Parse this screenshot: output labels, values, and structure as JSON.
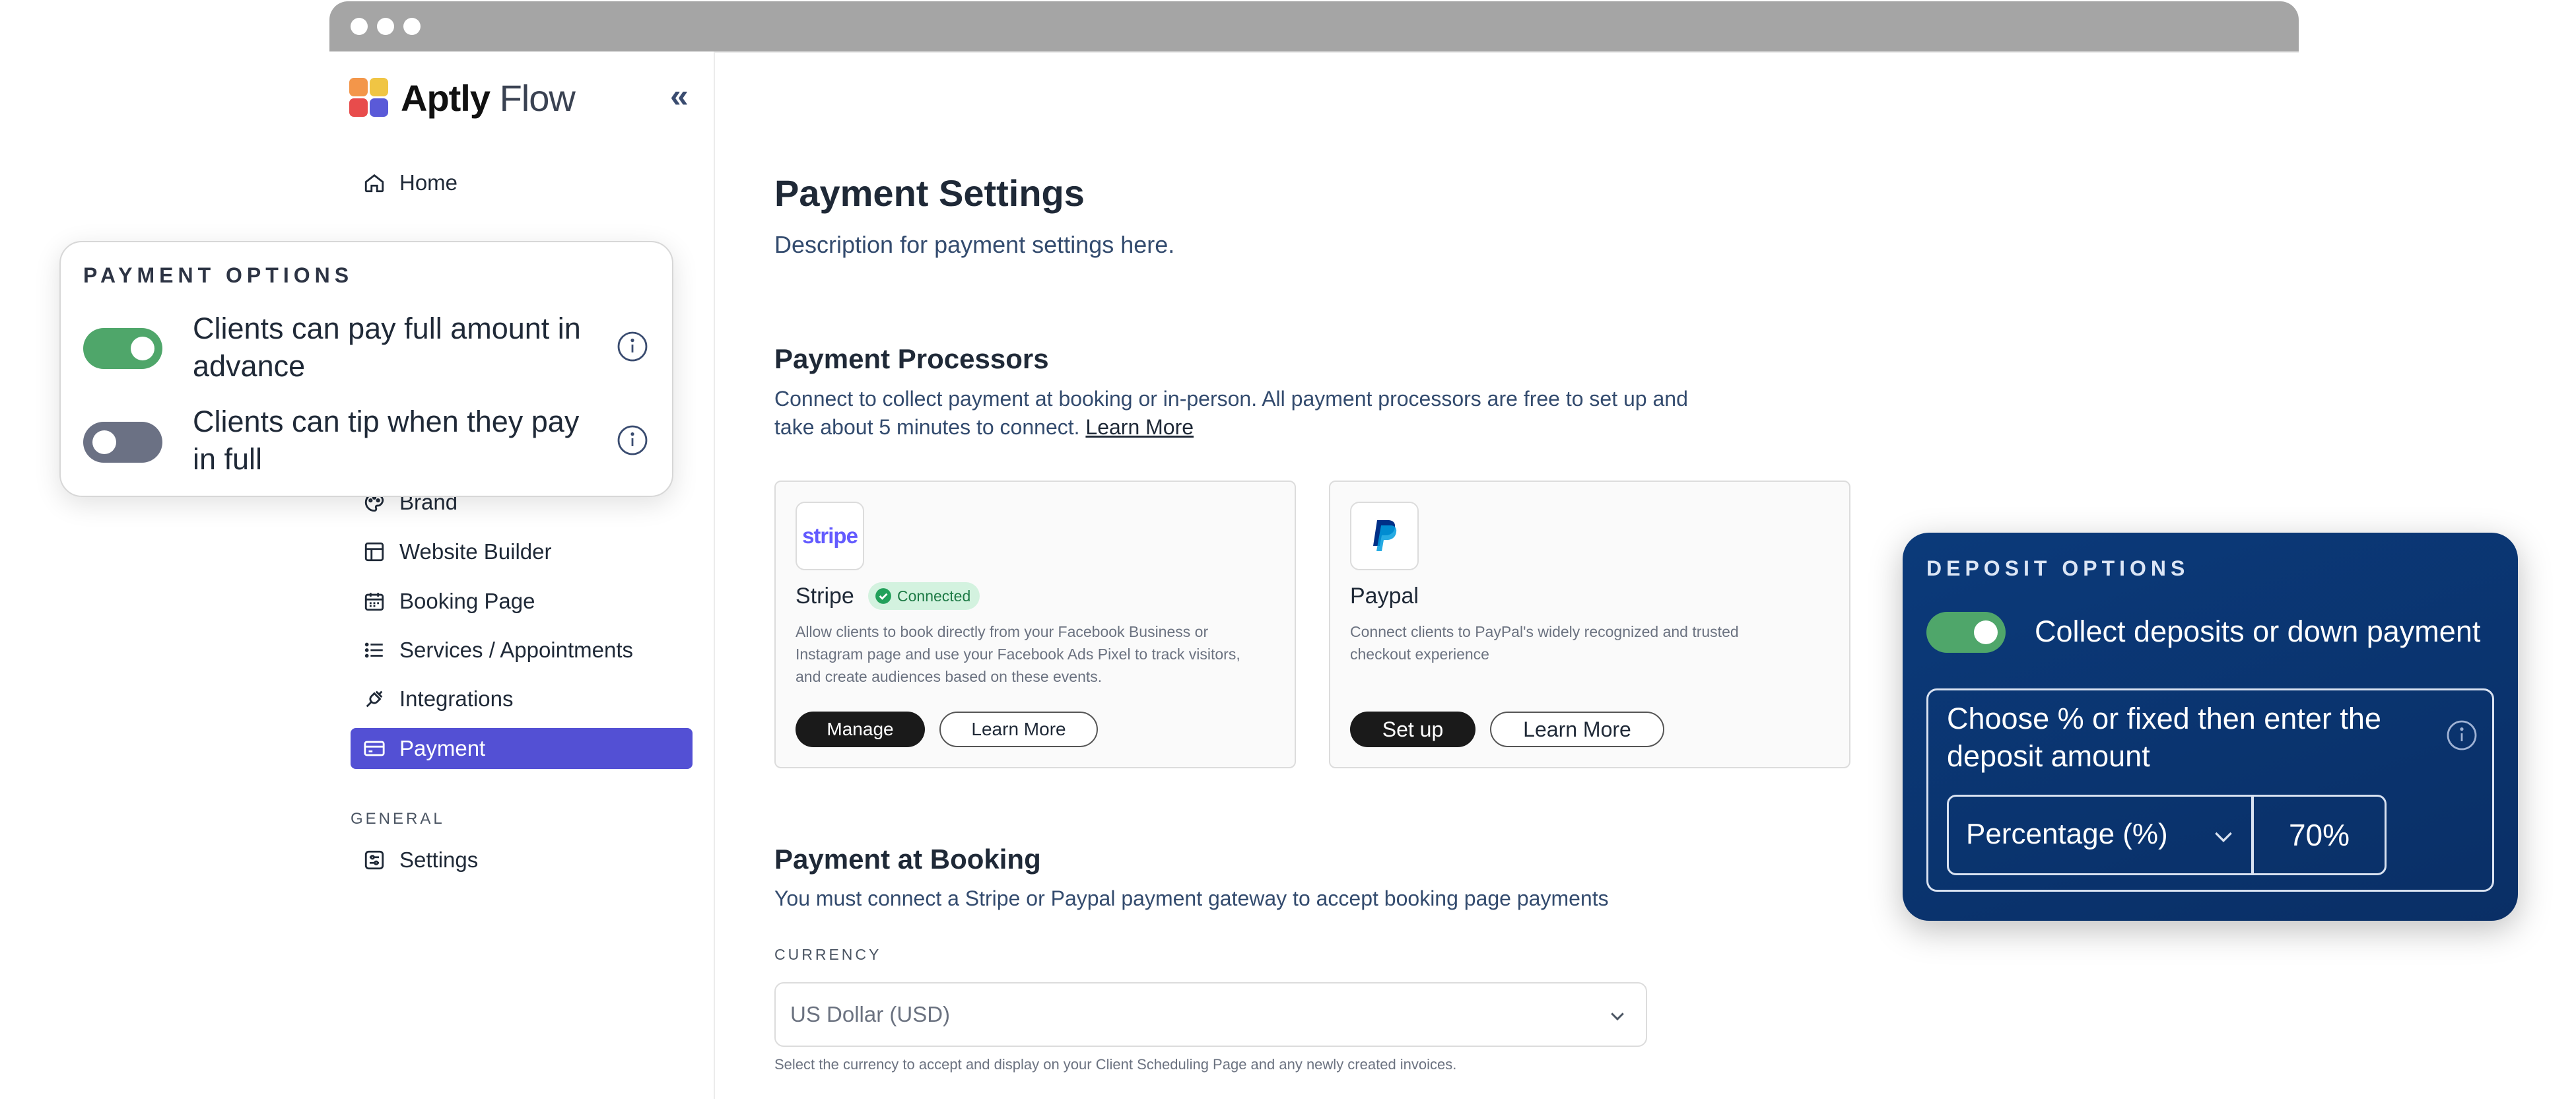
{
  "app": {
    "brand_bold": "Aptly",
    "brand_light": "Flow",
    "brand_colors": [
      "#f3964a",
      "#f0c544",
      "#e84c4c",
      "#5a5ad8"
    ],
    "collapse_glyph": "«"
  },
  "sidebar": {
    "items": [
      {
        "label": "Home",
        "icon": "home-icon"
      },
      {
        "label": "Brand",
        "icon": "palette-icon"
      },
      {
        "label": "Website Builder",
        "icon": "layout-icon"
      },
      {
        "label": "Booking Page",
        "icon": "calendar-icon"
      },
      {
        "label": "Services / Appointments",
        "icon": "list-icon"
      },
      {
        "label": "Integrations",
        "icon": "plug-icon"
      },
      {
        "label": "Payment",
        "icon": "credit-card-icon",
        "active": true
      }
    ],
    "general_heading": "GENERAL",
    "general_items": [
      {
        "label": "Settings",
        "icon": "settings-icon"
      }
    ],
    "active_color": "#5350d4"
  },
  "main": {
    "title": "Payment Settings",
    "description": "Description for payment settings here.",
    "processors": {
      "heading": "Payment Processors",
      "description_line1": "Connect to collect payment at booking or in-person. All payment processors are free to set up and",
      "description_line2": "take about 5 minutes to connect.",
      "learn_more": "Learn More",
      "cards": [
        {
          "name": "Stripe",
          "logo_text": "stripe",
          "badge": "Connected",
          "desc_line1": "Allow clients to book directly from your Facebook Business or",
          "desc_line2": "Instagram  page and use your Facebook Ads Pixel to track visitors,",
          "desc_line3": "and create  audiences based on these events.",
          "primary_button": "Manage",
          "secondary_button": "Learn More"
        },
        {
          "name": "Paypal",
          "desc_line1": "Connect clients to PayPal's widely recognized and trusted",
          "desc_line2": "checkout experience",
          "primary_button": "Set up",
          "secondary_button": "Learn More"
        }
      ]
    },
    "booking": {
      "heading": "Payment at Booking",
      "description": "You must connect a Stripe or Paypal payment gateway to accept booking page payments",
      "currency_label": "CURRENCY",
      "currency_value": "US Dollar (USD)",
      "currency_help": "Select the currency to accept and display on your Client Scheduling Page and any newly created invoices."
    }
  },
  "payment_options": {
    "heading": "PAYMENT OPTIONS",
    "options": [
      {
        "line1": "Clients can pay full amount in",
        "line2": "advance",
        "enabled": true
      },
      {
        "line1": "Clients can tip when they pay",
        "line2": "in full",
        "enabled": false
      }
    ],
    "toggle_on_color": "#4fa66a",
    "toggle_off_color": "#6b7184"
  },
  "deposit_options": {
    "heading": "DEPOSIT OPTIONS",
    "toggle_label": "Collect deposits or down payment",
    "enabled": true,
    "box_line1": "Choose % or fixed then enter the",
    "box_line2": "deposit amount",
    "type_value": "Percentage (%)",
    "amount_value": "70%"
  }
}
